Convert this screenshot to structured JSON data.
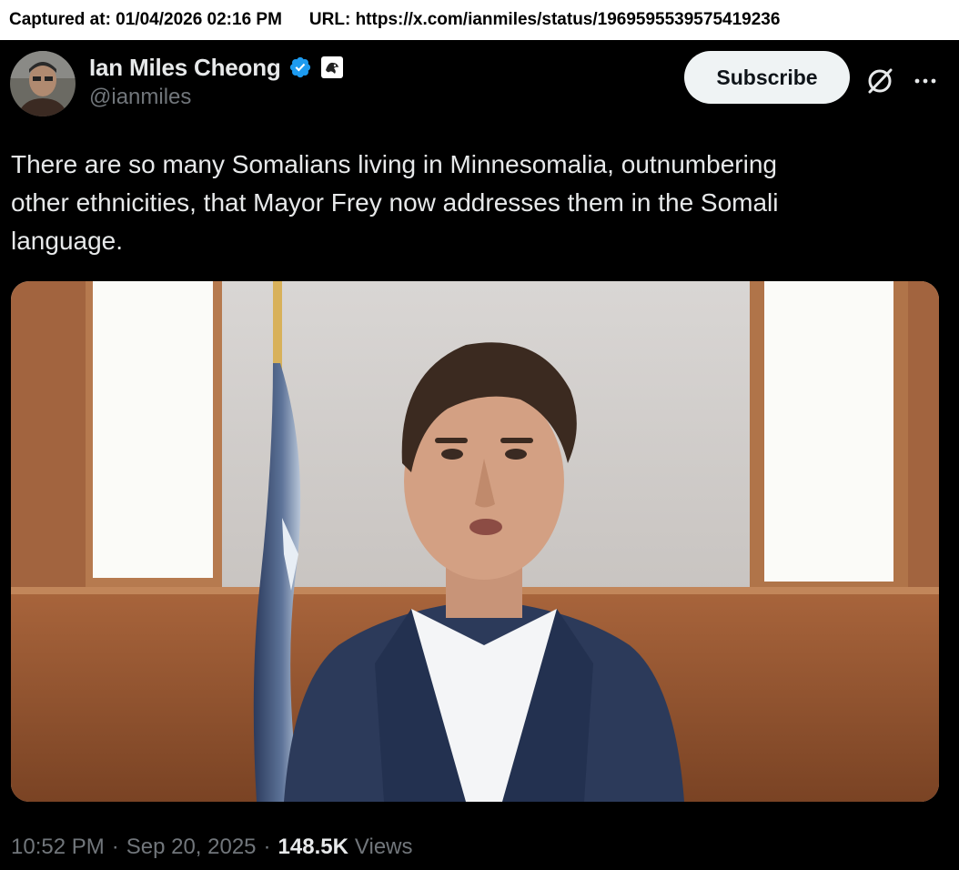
{
  "capture": {
    "captured_at": "Captured at: 01/04/2026 02:16 PM",
    "url": "URL: https://x.com/ianmiles/status/1969595539575419236"
  },
  "author": {
    "display_name": "Ian Miles Cheong",
    "handle": "@ianmiles",
    "verified": true
  },
  "actions": {
    "subscribe_label": "Subscribe",
    "grok_icon": "grok-icon",
    "more_icon": "more-icon"
  },
  "tweet": {
    "text_line1": "There are so many Somalians living in Minnesomalia, outnumbering",
    "text_line2": "other ethnicities, that Mayor Frey now addresses them in the Somali",
    "text_line3": "language."
  },
  "meta": {
    "time": "10:52 PM",
    "date": "Sep 20, 2025",
    "separator": "·",
    "views_count": "148.5K",
    "views_label": "Views"
  },
  "colors": {
    "background": "#000000",
    "text_primary": "#e7e9ea",
    "text_secondary": "#71767b",
    "verified_blue": "#1d9bf0",
    "subscribe_bg": "#eff3f4"
  }
}
